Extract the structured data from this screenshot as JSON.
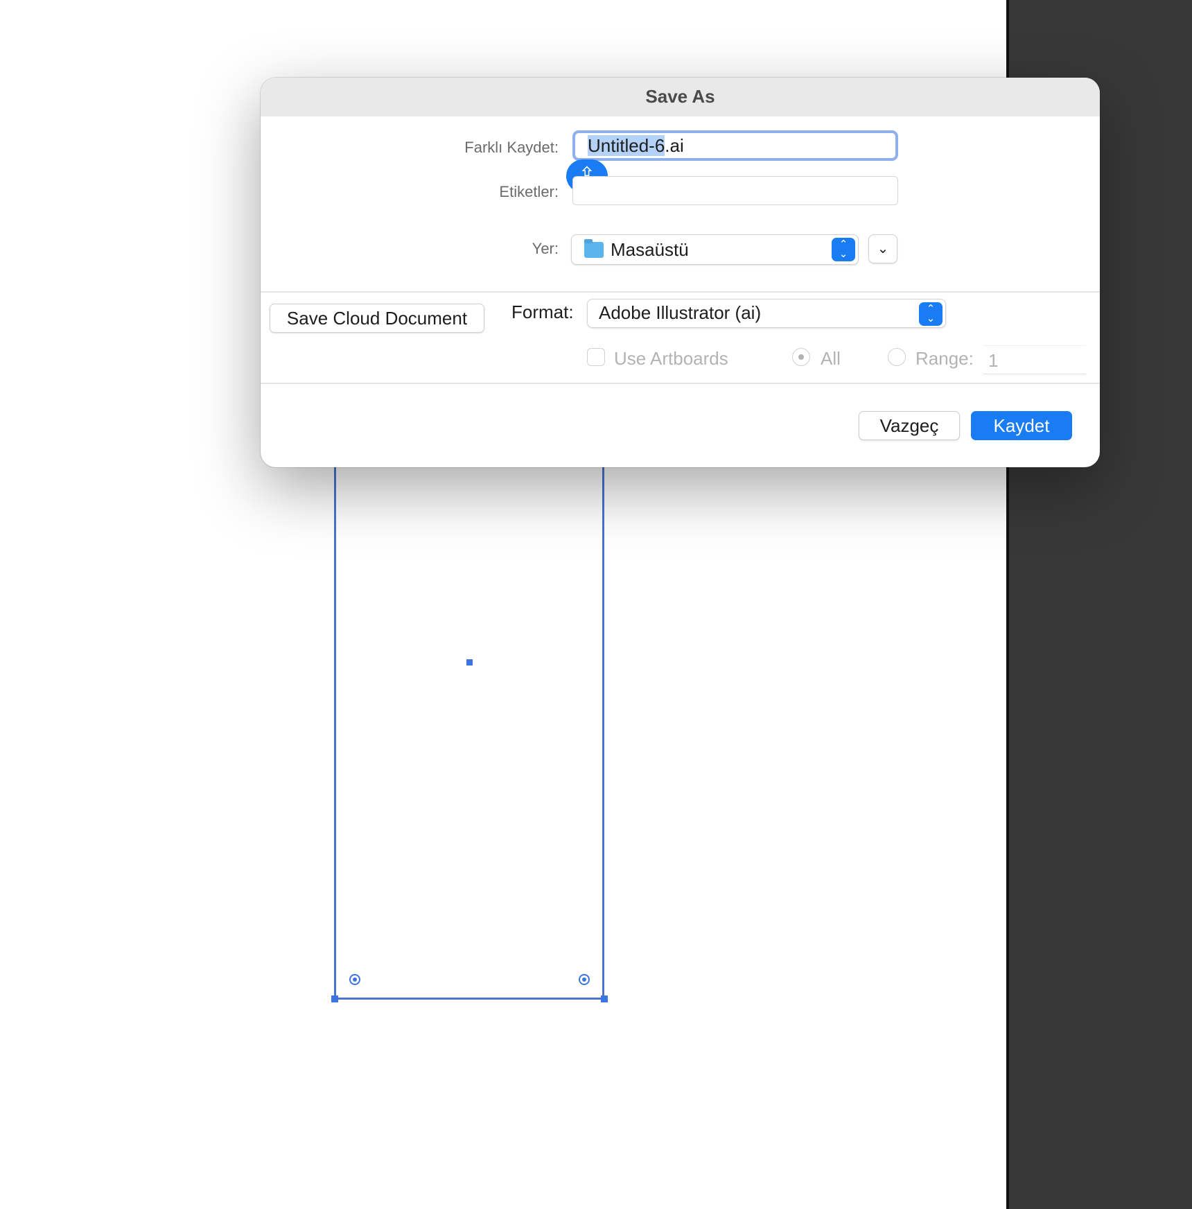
{
  "dialog": {
    "title": "Save As",
    "save_as_label": "Farklı Kaydet:",
    "filename_selected": "Untitled-6",
    "filename_ext": ".ai",
    "tags_label": "Etiketler:",
    "tags_value": "",
    "place_label": "Yer:",
    "place_value": "Masaüstü",
    "save_cloud_label": "Save Cloud Document",
    "format_label": "Format:",
    "format_value": "Adobe Illustrator (ai)",
    "use_artboards_label": "Use Artboards",
    "all_label": "All",
    "range_label": "Range:",
    "range_value": "1",
    "cancel_label": "Vazgeç",
    "save_label": "Kaydet"
  },
  "icons": {
    "shift": "shift-key-icon",
    "folder": "folder-icon",
    "stepper": "up-down-stepper-icon",
    "expand": "chevron-down-icon"
  },
  "colors": {
    "accent": "#1a7cf3",
    "focus_ring": "#8fb0ee",
    "selection": "#b4d2f7",
    "artboard_outline": "#4a74d0",
    "side_panel": "#383838"
  }
}
